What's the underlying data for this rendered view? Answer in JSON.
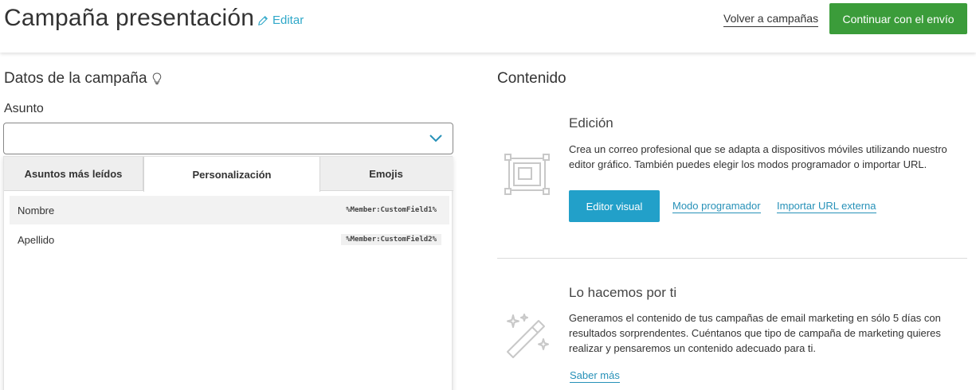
{
  "header": {
    "title": "Campaña presentación",
    "edit_label": "Editar",
    "back_label": "Volver a campañas",
    "continue_label": "Continuar con el envío"
  },
  "campaign_data": {
    "title": "Datos de la campaña",
    "subject_label": "Asunto",
    "subject_value": ""
  },
  "dropdown": {
    "tabs": [
      {
        "label": "Asuntos más leídos",
        "selected": false
      },
      {
        "label": "Personalización",
        "selected": true
      },
      {
        "label": "Emojis",
        "selected": false
      }
    ],
    "rows": [
      {
        "name": "Nombre",
        "code": "%Member:CustomField1%"
      },
      {
        "name": "Apellido",
        "code": "%Member:CustomField2%"
      }
    ]
  },
  "content": {
    "title": "Contenido",
    "edition": {
      "title": "Edición",
      "description": "Crea un correo profesional que se adapta a dispositivos móviles utilizando nuestro editor gráfico. También puedes elegir los modos programador o importar URL.",
      "visual_editor_label": "Editor visual",
      "programmer_mode_label": "Modo programador",
      "import_url_label": "Importar URL externa"
    },
    "done_for_you": {
      "title": "Lo hacemos por ti",
      "description": "Generamos el contenido de tus campañas de email marketing en sólo 5 días con resultados sorprendentes. Cuéntanos que tipo de campaña de marketing quieres realizar y pensaremos un contenido adecuado para ti.",
      "learn_more_label": "Saber más"
    }
  },
  "colors": {
    "accent": "#22a0c9",
    "primary_button": "#3b9c3a",
    "link": "#2791b8"
  },
  "icons": [
    "pencil-icon",
    "lightbulb-icon",
    "chevron-down-icon",
    "editor-layout-icon",
    "magic-wand-icon"
  ]
}
